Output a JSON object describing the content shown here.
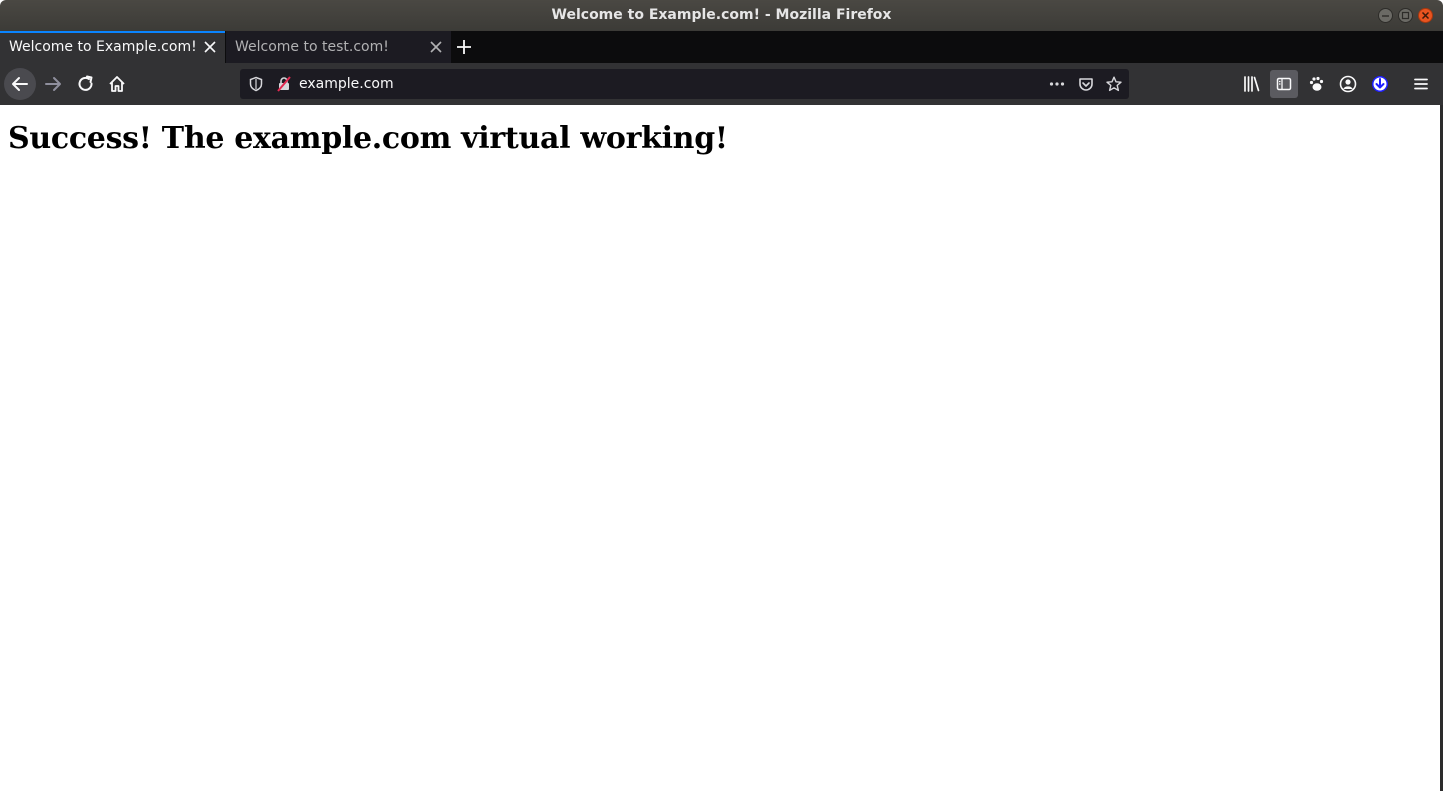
{
  "window": {
    "title": "Welcome to Example.com! - Mozilla Firefox"
  },
  "tabs": [
    {
      "label": "Welcome to Example.com!",
      "active": true
    },
    {
      "label": "Welcome to test.com!",
      "active": false
    }
  ],
  "urlbar": {
    "url": "example.com"
  },
  "icons": {
    "back": "back-arrow-icon",
    "forward": "forward-arrow-icon",
    "reload": "reload-icon",
    "home": "home-icon",
    "shield": "tracking-protection-shield-icon",
    "insecure": "insecure-connection-icon",
    "page_actions": "more-actions-icon",
    "pocket": "pocket-icon",
    "bookmark": "bookmark-star-icon",
    "library": "library-icon",
    "sidebar": "sidebar-icon",
    "extension": "extension-paw-icon",
    "account": "account-icon",
    "downloads": "downloads-icon",
    "menu": "hamburger-menu-icon"
  },
  "colors": {
    "active_tab_accent": "#0a84ff",
    "close_button": "#e95420",
    "toolbar_bg": "#323234"
  },
  "page": {
    "heading": "Success! The example.com virtual working!"
  }
}
